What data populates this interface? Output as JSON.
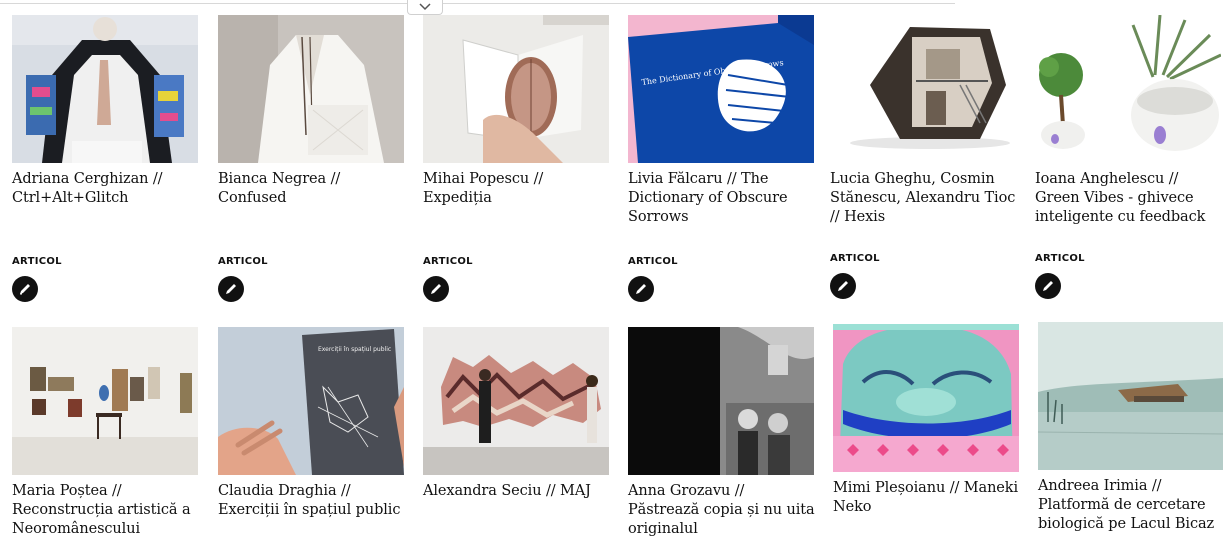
{
  "cards": [
    {
      "title": "Adriana Cerghizan // Ctrl+Alt+Glitch",
      "tag": "ARTICOL",
      "icon": "edit-pen-icon"
    },
    {
      "title": "Bianca Negrea // Confused",
      "tag": "ARTICOL",
      "icon": "edit-pen-icon"
    },
    {
      "title": "Mihai Popescu // Expediția",
      "tag": "ARTICOL",
      "icon": "edit-pen-icon"
    },
    {
      "title": "Livia Fălcaru // The Dictionary of Obscure Sorrows",
      "tag": "ARTICOL",
      "icon": "edit-pen-icon"
    },
    {
      "title": "Lucia Gheghu, Cosmin Stănescu, Alexandru Tioc // Hexis",
      "tag": "ARTICOL",
      "icon": "edit-pen-icon"
    },
    {
      "title": "Ioana Anghelescu // Green Vibes - ghivece inteligente cu feedback",
      "tag": "ARTICOL",
      "icon": "edit-pen-icon"
    },
    {
      "title": "Maria Poștea // Reconstrucția artistică a Neoromânescului"
    },
    {
      "title": "Claudia Draghia // Exerciții în spațiul public"
    },
    {
      "title": "Alexandra Seciu // MAJ"
    },
    {
      "title": "Anna Grozavu // Păstrează copia și nu uita originalul"
    },
    {
      "title": "Mimi Pleșoianu // Maneki Neko"
    },
    {
      "title": "Andreea Irimia // Platformă de cercetare biologică pe Lacul Bicaz"
    }
  ],
  "book_cover_text": "The Dictionary of Obscure Sorrows",
  "grey_book_text": "Exerciții în spațiul public",
  "colors": {
    "text": "#111111",
    "badge": "#111111",
    "topline": "#d8d8d8"
  }
}
